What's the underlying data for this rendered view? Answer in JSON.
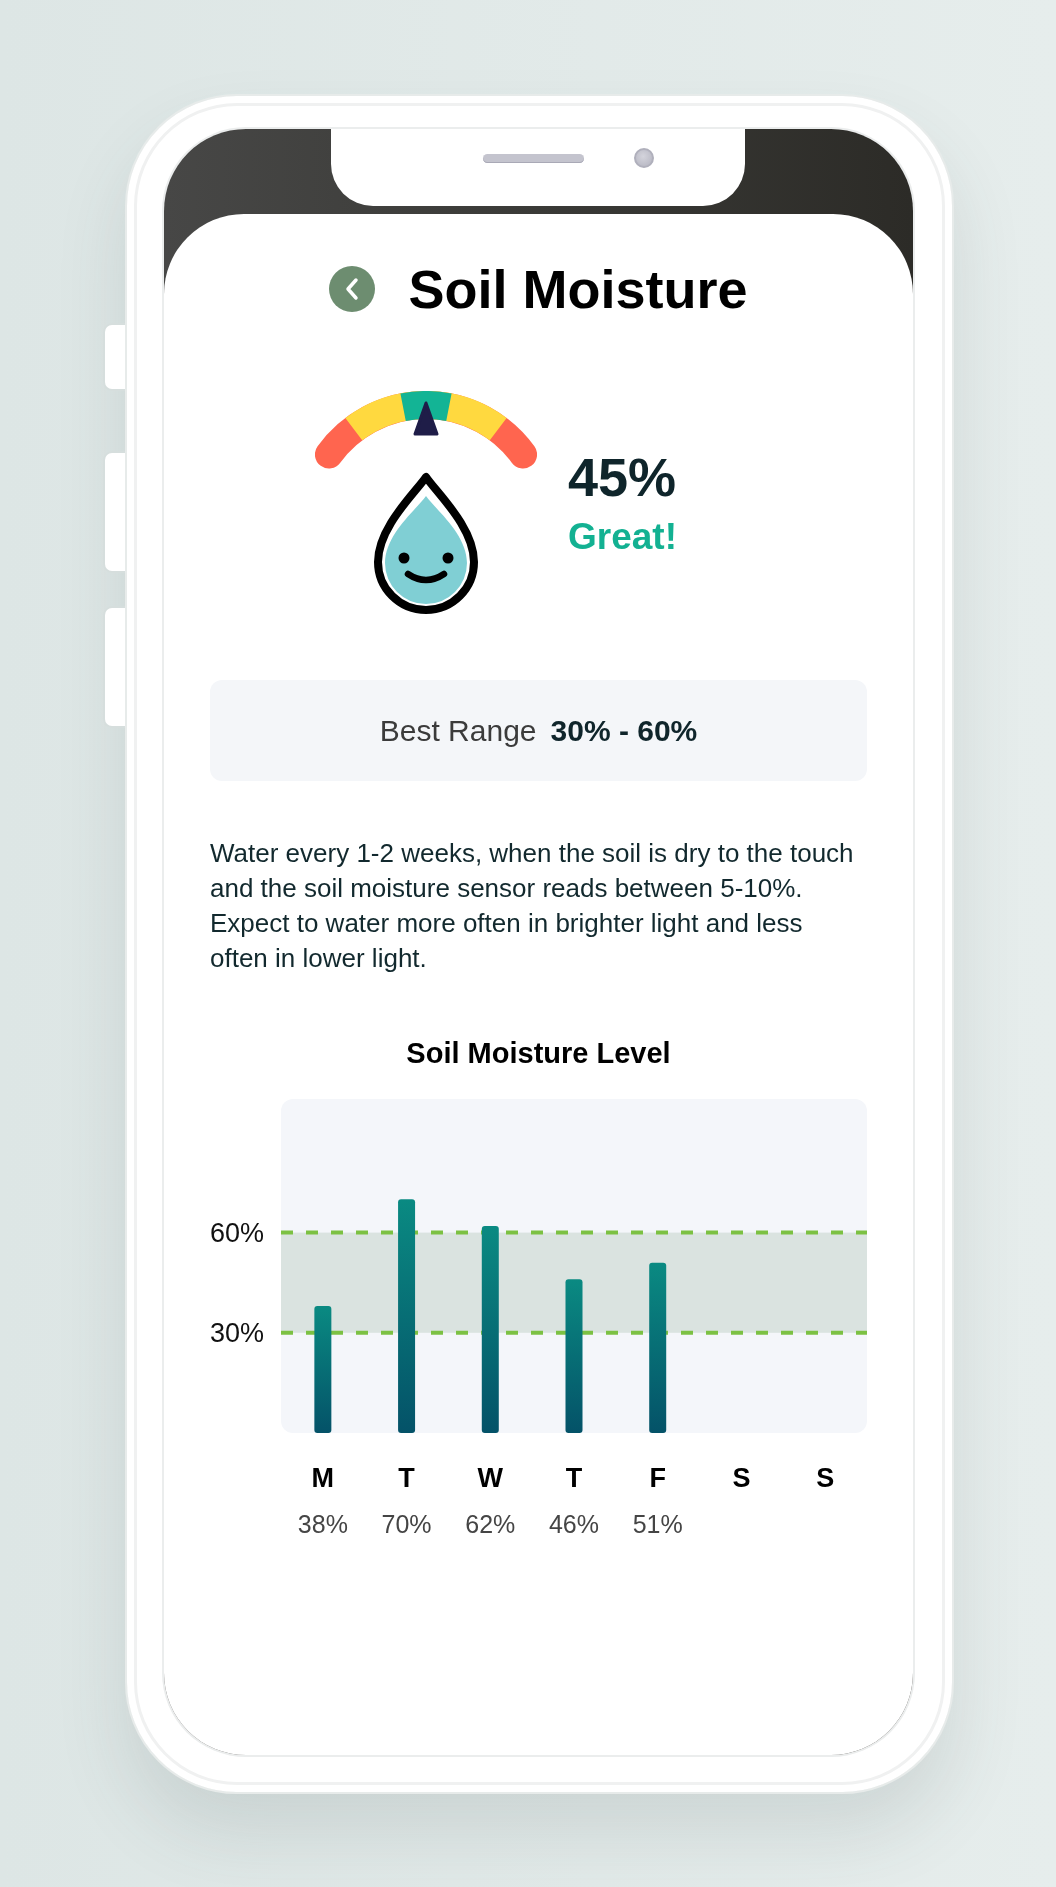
{
  "header": {
    "title": "Soil Moisture"
  },
  "gauge": {
    "level": 0.5,
    "reading": "45%",
    "status": "Great!"
  },
  "best_range": {
    "label": "Best Range",
    "value": "30% - 60%"
  },
  "description": "Water every 1-2 weeks, when the soil is dry to the touch and the soil moisture sensor reads between 5-10%.\nExpect to water more often in brighter light and less often in lower light.",
  "chart": {
    "chart_data": {
      "type": "bar",
      "title": "Soil Moisture Level",
      "categories": [
        "M",
        "T",
        "W",
        "T",
        "F",
        "S",
        "S"
      ],
      "values": [
        38,
        70,
        62,
        46,
        51,
        null,
        null
      ],
      "ylim": [
        0,
        100
      ],
      "yticks": [
        {
          "value": 30,
          "label": "30%"
        },
        {
          "value": 60,
          "label": "60%"
        }
      ],
      "value_labels": [
        "38%",
        "70%",
        "62%",
        "46%",
        "51%",
        null,
        null
      ],
      "bands": [
        {
          "axis": "y",
          "from": 30,
          "to": 60
        }
      ]
    }
  }
}
